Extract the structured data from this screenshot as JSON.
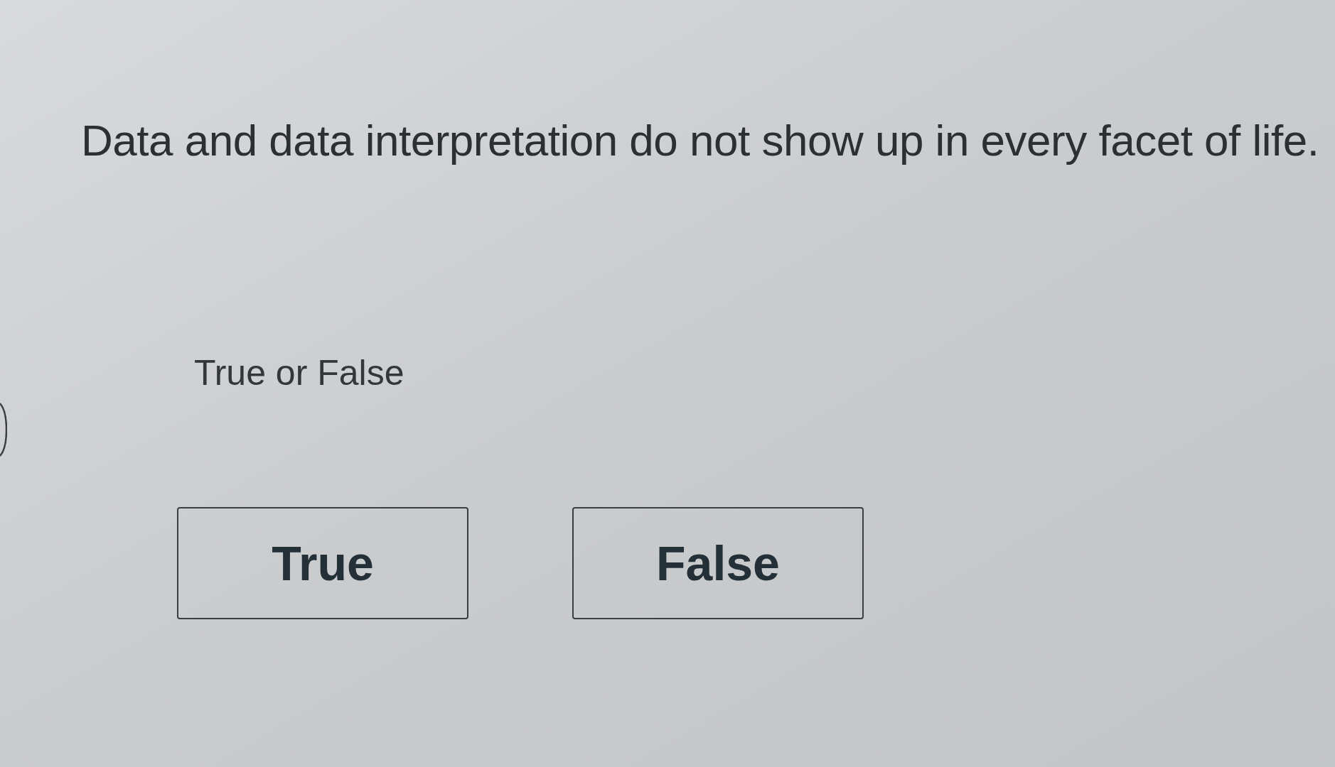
{
  "question": {
    "text": "Data and data interpretation do not show up in every facet of life."
  },
  "prompt": "True or False",
  "choices": [
    {
      "label": "True",
      "selected": false
    },
    {
      "label": "False",
      "selected": false
    }
  ]
}
